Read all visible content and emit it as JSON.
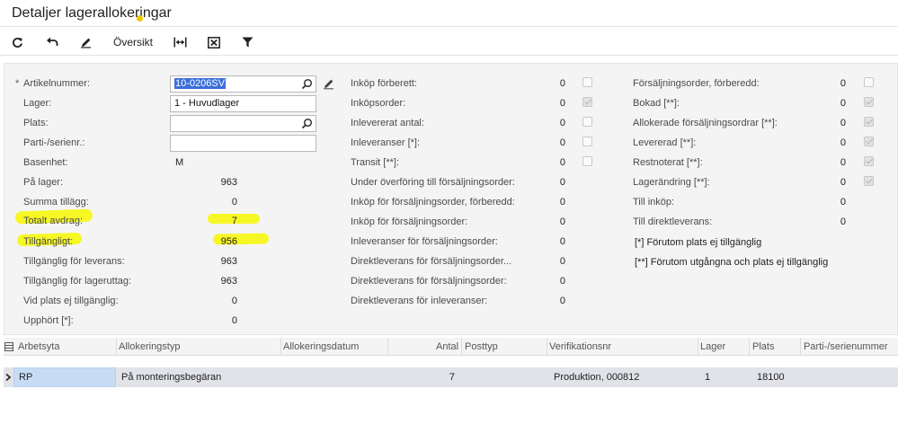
{
  "page": {
    "title": "Detaljer lagerallokeringar"
  },
  "toolbar": {
    "refresh_icon": "refresh-icon",
    "undo_icon": "undo-icon",
    "edit_icon": "pencil-icon",
    "overview_label": "Översikt",
    "fit_icon": "fit-columns-icon",
    "export_icon": "export-excel-icon",
    "filter_icon": "filter-icon"
  },
  "form": {
    "left": {
      "artikelnummer_label": "Artikelnummer:",
      "artikelnummer_value": "10-0206SV",
      "lager_label": "Lager:",
      "lager_value": "1 - Huvudlager",
      "plats_label": "Plats:",
      "plats_value": "",
      "parti_label": "Parti-/serienr.:",
      "parti_value": "",
      "basenhet_label": "Basenhet:",
      "basenhet_value": "M",
      "pa_lager_label": "På lager:",
      "pa_lager_value": "963",
      "summa_label": "Summa tillägg:",
      "summa_value": "0",
      "totalt_label": "Totalt avdrag:",
      "totalt_value": "7",
      "tillgangligt_label": "Tillgängligt:",
      "tillgangligt_value": "956",
      "leverans_label": "Tillgänglig för leverans:",
      "leverans_value": "963",
      "lageruttag_label": "Tillgänglig för lageruttag:",
      "lageruttag_value": "963",
      "vid_plats_label": "Vid plats ej tillgänglig:",
      "vid_plats_value": "0",
      "upphort_label": "Upphört [*]:",
      "upphort_value": "0"
    },
    "middle": [
      {
        "label": "Inköp förberett:",
        "value": "0",
        "checkbox": "unchecked"
      },
      {
        "label": "Inköpsorder:",
        "value": "0",
        "checkbox": "checked"
      },
      {
        "label": "Inlevererat antal:",
        "value": "0",
        "checkbox": "unchecked"
      },
      {
        "label": "Inleveranser [*]:",
        "value": "0",
        "checkbox": "unchecked"
      },
      {
        "label": "Transit [**]:",
        "value": "0",
        "checkbox": "unchecked"
      },
      {
        "label": "Under överföring till försäljningsorder:",
        "value": "0"
      },
      {
        "label": "Inköp för försäljningsorder, förberedd:",
        "value": "0"
      },
      {
        "label": "Inköp för försäljningsorder:",
        "value": "0"
      },
      {
        "label": "Inleveranser för försäljningsorder:",
        "value": "0"
      },
      {
        "label": "Direktleverans för försäljningsorder...",
        "value": "0"
      },
      {
        "label": "Direktleverans för försäljningsorder:",
        "value": "0"
      },
      {
        "label": "Direktleverans för inleveranser:",
        "value": "0"
      }
    ],
    "right": [
      {
        "label": "Försäljningsorder, förberedd:",
        "value": "0",
        "checkbox": "unchecked"
      },
      {
        "label": "Bokad [**]:",
        "value": "0",
        "checkbox": "checked"
      },
      {
        "label": "Allokerade försäljningsordrar [**]:",
        "value": "0",
        "checkbox": "checked"
      },
      {
        "label": "Levererad [**]:",
        "value": "0",
        "checkbox": "checked"
      },
      {
        "label": "Restnoterat [**]:",
        "value": "0",
        "checkbox": "checked"
      },
      {
        "label": "Lagerändring [**]:",
        "value": "0",
        "checkbox": "checked"
      },
      {
        "label": "Till inköp:",
        "value": "0"
      },
      {
        "label": "Till direktleverans:",
        "value": "0"
      }
    ],
    "notes": {
      "note1": "[*]  Förutom plats ej tillgänglig",
      "note2": "[**]  Förutom utgångna och plats ej tillgänglig"
    }
  },
  "grid": {
    "columns": [
      "Arbetsyta",
      "Allokeringstyp",
      "Allokeringsdatum",
      "Antal",
      "Posttyp",
      "Verifikationsnr",
      "Lager",
      "Plats",
      "Parti-/serienummer"
    ],
    "rows": [
      {
        "arbetsyta": "RP",
        "allokeringstyp": "På monteringsbegäran",
        "allokeringsdatum": "",
        "antal": "7",
        "posttyp": "",
        "verifikationsnr": "Produktion, 000812",
        "lager": "1",
        "plats": "18100",
        "parti": ""
      }
    ]
  },
  "colors": {
    "highlight": "#f7f700",
    "selection": "#3a6fd8",
    "active_cell": "#c6dcf4",
    "row_bg": "#e1e3e8"
  }
}
